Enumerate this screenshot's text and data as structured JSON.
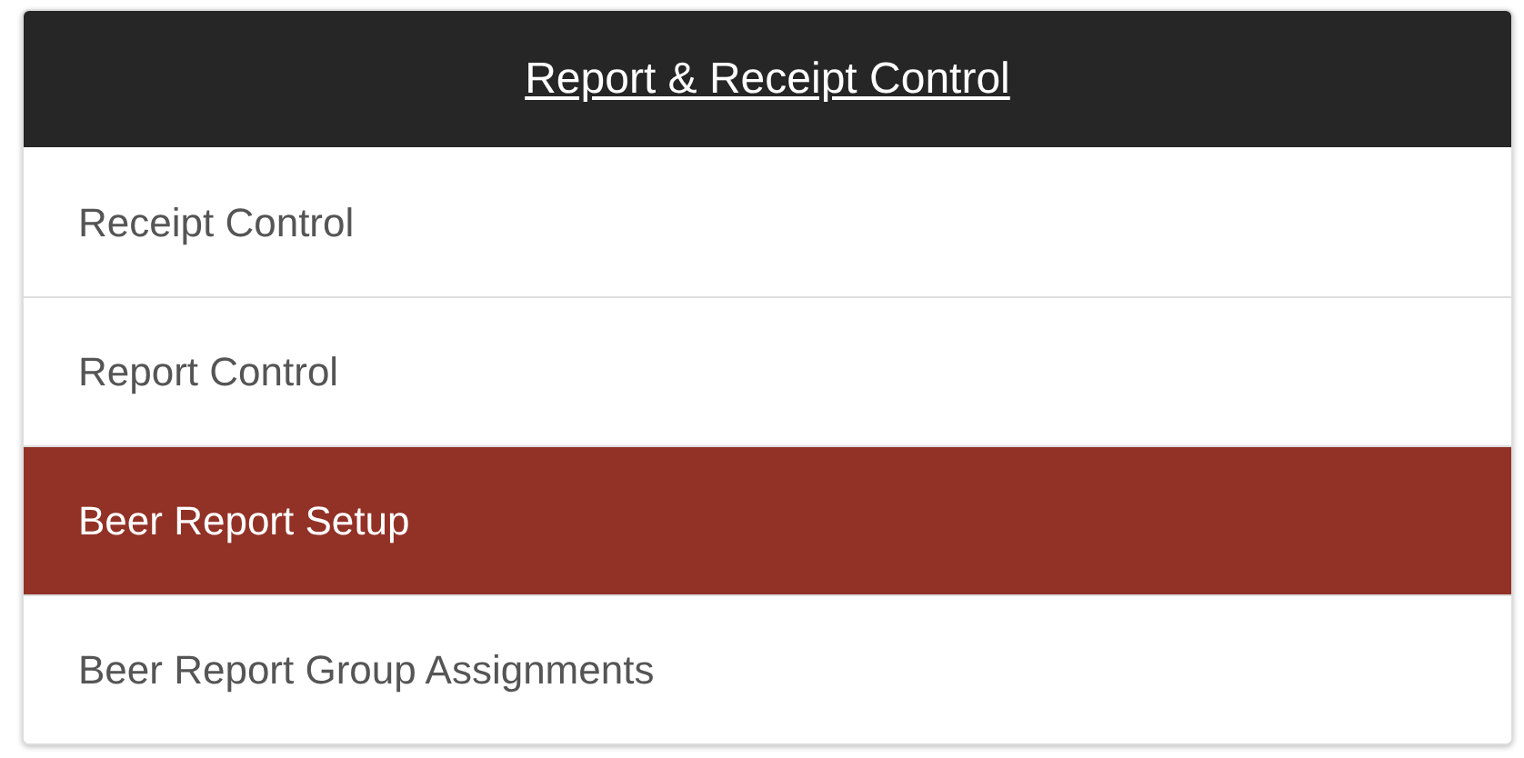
{
  "menu": {
    "title": "Report & Receipt Control",
    "items": [
      {
        "label": "Receipt Control",
        "selected": false
      },
      {
        "label": "Report Control",
        "selected": false
      },
      {
        "label": "Beer Report Setup",
        "selected": true
      },
      {
        "label": "Beer Report Group Assignments",
        "selected": false
      }
    ]
  }
}
